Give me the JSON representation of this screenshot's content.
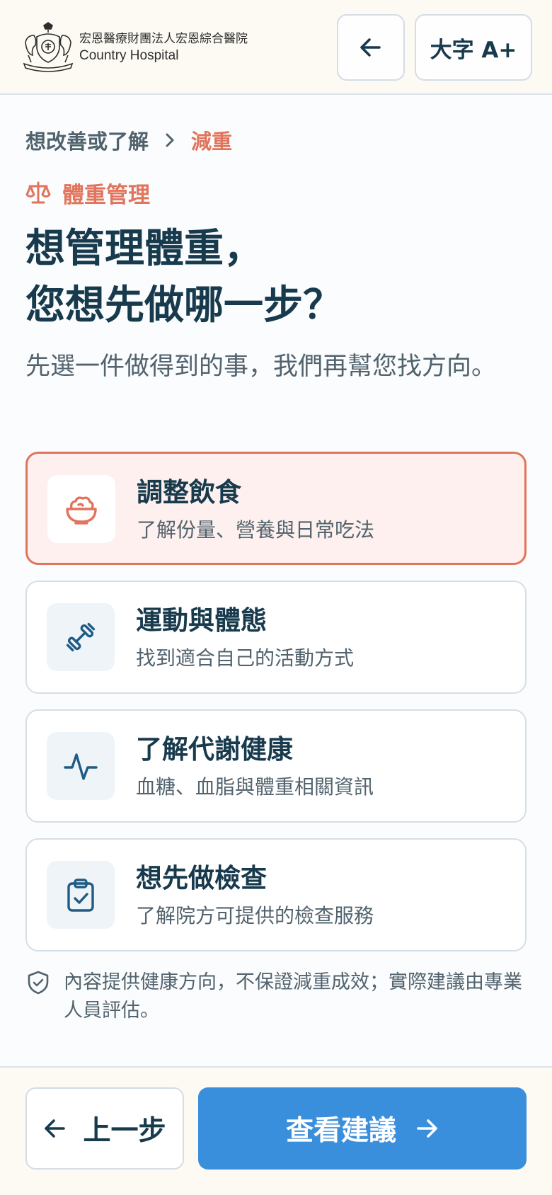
{
  "header": {
    "org_name": "宏恩醫療財團法人宏恩綜合醫院",
    "org_subtitle": "Country Hospital",
    "logo_icon": "hospital-crest-logo",
    "back_icon": "arrow-left-icon",
    "font_size_label": "大字 A+"
  },
  "breadcrumb": {
    "parent": "想改善或了解",
    "separator_icon": "chevron-right-icon",
    "current": "減重"
  },
  "category": {
    "icon": "scale-icon",
    "label": "體重管理"
  },
  "title": {
    "line1": "想管理體重，",
    "line2": "您想先做哪一步？"
  },
  "subtitle": "先選一件做得到的事，我們再幫您找方向。",
  "options": [
    {
      "title": "調整飲食",
      "description": "了解份量、營養與日常吃法",
      "icon": "food-bowl-icon",
      "selected": true
    },
    {
      "title": "運動與體態",
      "description": "找到適合自己的活動方式",
      "icon": "dumbbell-icon",
      "selected": false
    },
    {
      "title": "了解代謝健康",
      "description": "血糖、血脂與體重相關資訊",
      "icon": "pulse-icon",
      "selected": false
    },
    {
      "title": "想先做檢查",
      "description": "了解院方可提供的檢查服務",
      "icon": "clipboard-check-icon",
      "selected": false
    }
  ],
  "disclaimer": {
    "icon": "shield-icon",
    "text": "內容提供健康方向，不保證減重成效；實際建議由專業人員評估。"
  },
  "footer": {
    "prev_label": "上一步",
    "next_label": "查看建議"
  },
  "colors": {
    "accent": "#e1745c",
    "primary": "#3a8fdc",
    "text": "#183a4d",
    "muted": "#52636e",
    "selected_bg": "#fdf0ee",
    "header_bg": "#fcfaf3"
  }
}
